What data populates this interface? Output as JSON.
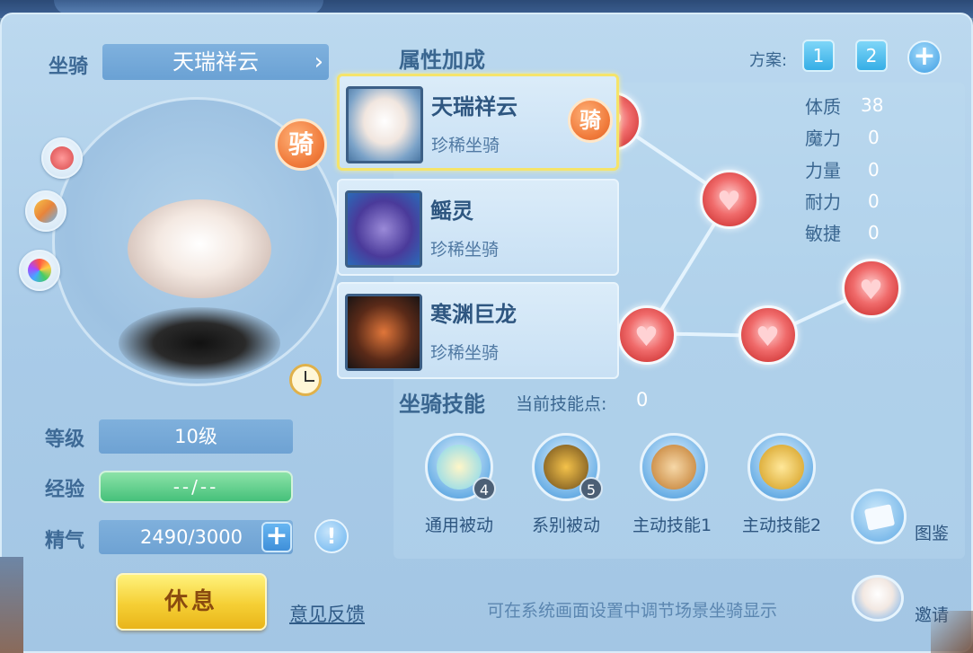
{
  "header": {
    "mount_label": "坐骑",
    "mount_name": "天瑞祥云"
  },
  "stats_left": {
    "level_label": "等级",
    "level_value": "10级",
    "exp_label": "经验",
    "exp_value": "--/--",
    "energy_label": "精气",
    "energy_value": "2490/3000",
    "energy_plus": "+",
    "info_icon": "!"
  },
  "ride_badge": "骑",
  "buttons": {
    "rest": "休息",
    "feedback": "意见反馈"
  },
  "attributes": {
    "title": "属性加成",
    "plan_label": "方案:",
    "plans": [
      "1",
      "2"
    ],
    "plan_add": "+",
    "stats": [
      {
        "name": "体质",
        "value": "38"
      },
      {
        "name": "魔力",
        "value": "0"
      },
      {
        "name": "力量",
        "value": "0"
      },
      {
        "name": "耐力",
        "value": "0"
      },
      {
        "name": "敏捷",
        "value": "0"
      }
    ]
  },
  "mount_list": [
    {
      "name": "天瑞祥云",
      "rarity": "珍稀坐骑",
      "badge": "骑",
      "selected": true
    },
    {
      "name": "鳐灵",
      "rarity": "珍稀坐骑",
      "selected": false
    },
    {
      "name": "寒渊巨龙",
      "rarity": "珍稀坐骑",
      "selected": false
    }
  ],
  "skills": {
    "title": "坐骑技能",
    "points_label": "当前技能点:",
    "points_value": "0",
    "items": [
      {
        "label": "通用被动",
        "count": "4"
      },
      {
        "label": "系别被动",
        "count": "5"
      },
      {
        "label": "主动技能1"
      },
      {
        "label": "主动技能2"
      }
    ]
  },
  "side_buttons": {
    "codex": "图鉴",
    "invite": "邀请"
  },
  "hint": "可在系统画面设置中调节场景坐骑显示",
  "icons": {
    "heart_node": "heart-icon",
    "clock": "clock-icon",
    "chevron": "chevron-right-icon"
  },
  "colors": {
    "panel_bg": "#a9cbe8",
    "accent_blue": "#3a6690",
    "rest_yellow": "#f5cf35",
    "exp_green": "#45c07a",
    "node_red": "#f06b6b"
  }
}
